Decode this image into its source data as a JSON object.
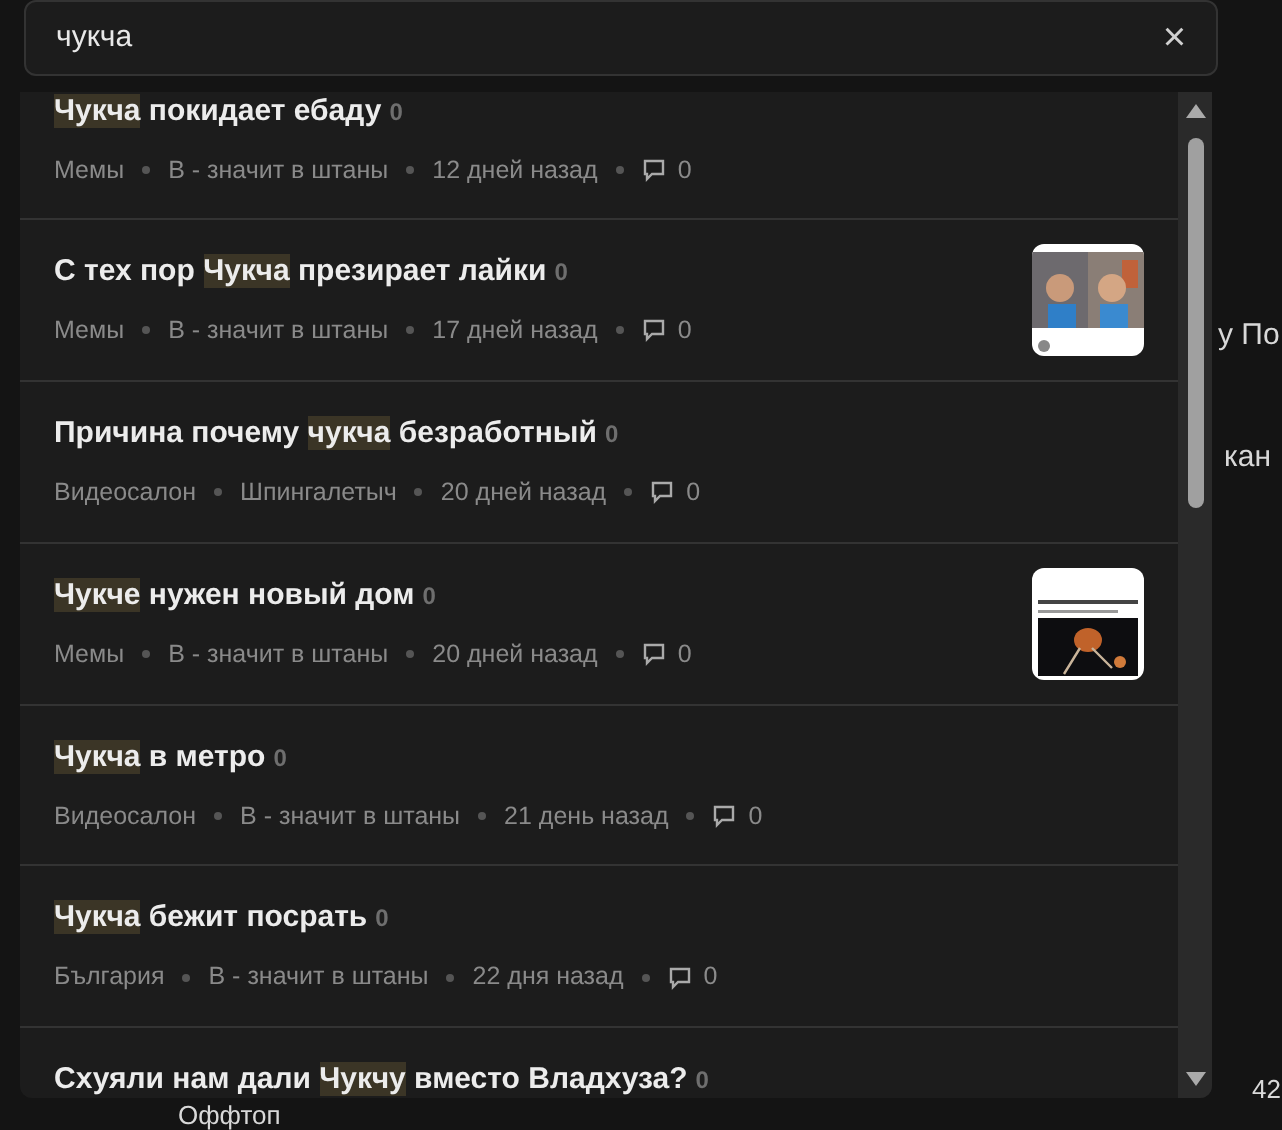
{
  "search": {
    "value": "чукча",
    "clear": "×"
  },
  "results": [
    {
      "title": [
        {
          "text": "Чукча",
          "highlight": true
        },
        {
          "text": " покидает ебаду",
          "highlight": false
        }
      ],
      "count": "0",
      "category": "Мемы",
      "author": "В - значит в штаны",
      "time": "12 дней назад",
      "comments": "0"
    },
    {
      "title": [
        {
          "text": "С тех пор ",
          "highlight": false
        },
        {
          "text": "Чукча",
          "highlight": true
        },
        {
          "text": " презирает лайки",
          "highlight": false
        }
      ],
      "count": "0",
      "category": "Мемы",
      "author": "В - значит в штаны",
      "time": "17 дней назад",
      "comments": "0",
      "thumbnail": {
        "kind": "picture"
      }
    },
    {
      "title": [
        {
          "text": "Причина почему ",
          "highlight": false
        },
        {
          "text": "чукча",
          "highlight": true
        },
        {
          "text": " безработный",
          "highlight": false
        }
      ],
      "count": "0",
      "category": "Видеосалон",
      "author": "Шпингалетыч",
      "time": "20 дней назад",
      "comments": "0"
    },
    {
      "title": [
        {
          "text": "Чукче",
          "highlight": true
        },
        {
          "text": " нужен новый дом",
          "highlight": false
        }
      ],
      "count": "0",
      "category": "Мемы",
      "author": "В - значит в штаны",
      "time": "20 дней назад",
      "comments": "0",
      "thumbnail": {
        "kind": "picture"
      }
    },
    {
      "title": [
        {
          "text": "Чукча",
          "highlight": true
        },
        {
          "text": " в метро",
          "highlight": false
        }
      ],
      "count": "0",
      "category": "Видеосалон",
      "author": "В - значит в штаны",
      "time": "21 день назад",
      "comments": "0"
    },
    {
      "title": [
        {
          "text": "Чукча",
          "highlight": true
        },
        {
          "text": " бежит посрать",
          "highlight": false
        }
      ],
      "count": "0",
      "category": "България",
      "author": "В - значит в штаны",
      "time": "22 дня назад",
      "comments": "0"
    },
    {
      "title": [
        {
          "text": "Схуяли нам дали ",
          "highlight": false
        },
        {
          "text": "Чукчу",
          "highlight": true
        },
        {
          "text": " вместо Владхуза?",
          "highlight": false
        }
      ],
      "count": "0"
    }
  ],
  "background": {
    "fragment_1": "у По",
    "fragment_2": "кан",
    "fragment_3": "Оффтоп",
    "fragment_4": "42"
  }
}
